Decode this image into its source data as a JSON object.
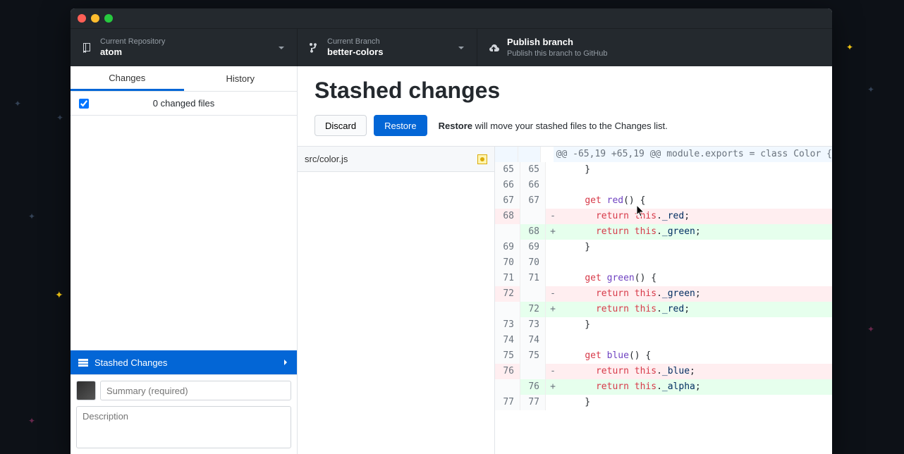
{
  "toolbar": {
    "repo": {
      "label": "Current Repository",
      "value": "atom"
    },
    "branch": {
      "label": "Current Branch",
      "value": "better-colors"
    },
    "publish": {
      "label": "Publish branch",
      "value": "Publish this branch to GitHub"
    }
  },
  "sidebar": {
    "tabs": {
      "changes": "Changes",
      "history": "History"
    },
    "changes_count": "0 changed files",
    "stashed_label": "Stashed Changes",
    "summary_placeholder": "Summary (required)",
    "desc_placeholder": "Description"
  },
  "main": {
    "title": "Stashed changes",
    "discard": "Discard",
    "restore": "Restore",
    "hint_bold": "Restore",
    "hint_rest": " will move your stashed files to the Changes list.",
    "file": "src/color.js"
  },
  "diff": {
    "hunk": "@@ -65,19 +65,19 @@ module.exports = class Color {",
    "lines": [
      {
        "old": "65",
        "new": "65",
        "type": "ctx",
        "text": "    }"
      },
      {
        "old": "66",
        "new": "66",
        "type": "ctx",
        "text": ""
      },
      {
        "old": "67",
        "new": "67",
        "type": "ctx",
        "text": "    get red() {"
      },
      {
        "old": "68",
        "new": "",
        "type": "del",
        "text": "      return this._red;"
      },
      {
        "old": "",
        "new": "68",
        "type": "add",
        "text": "      return this._green;"
      },
      {
        "old": "69",
        "new": "69",
        "type": "ctx",
        "text": "    }"
      },
      {
        "old": "70",
        "new": "70",
        "type": "ctx",
        "text": ""
      },
      {
        "old": "71",
        "new": "71",
        "type": "ctx",
        "text": "    get green() {"
      },
      {
        "old": "72",
        "new": "",
        "type": "del",
        "text": "      return this._green;"
      },
      {
        "old": "",
        "new": "72",
        "type": "add",
        "text": "      return this._red;"
      },
      {
        "old": "73",
        "new": "73",
        "type": "ctx",
        "text": "    }"
      },
      {
        "old": "74",
        "new": "74",
        "type": "ctx",
        "text": ""
      },
      {
        "old": "75",
        "new": "75",
        "type": "ctx",
        "text": "    get blue() {"
      },
      {
        "old": "76",
        "new": "",
        "type": "del",
        "text": "      return this._blue;"
      },
      {
        "old": "",
        "new": "76",
        "type": "add",
        "text": "      return this._alpha;"
      },
      {
        "old": "77",
        "new": "77",
        "type": "ctx",
        "text": "    }"
      }
    ]
  }
}
